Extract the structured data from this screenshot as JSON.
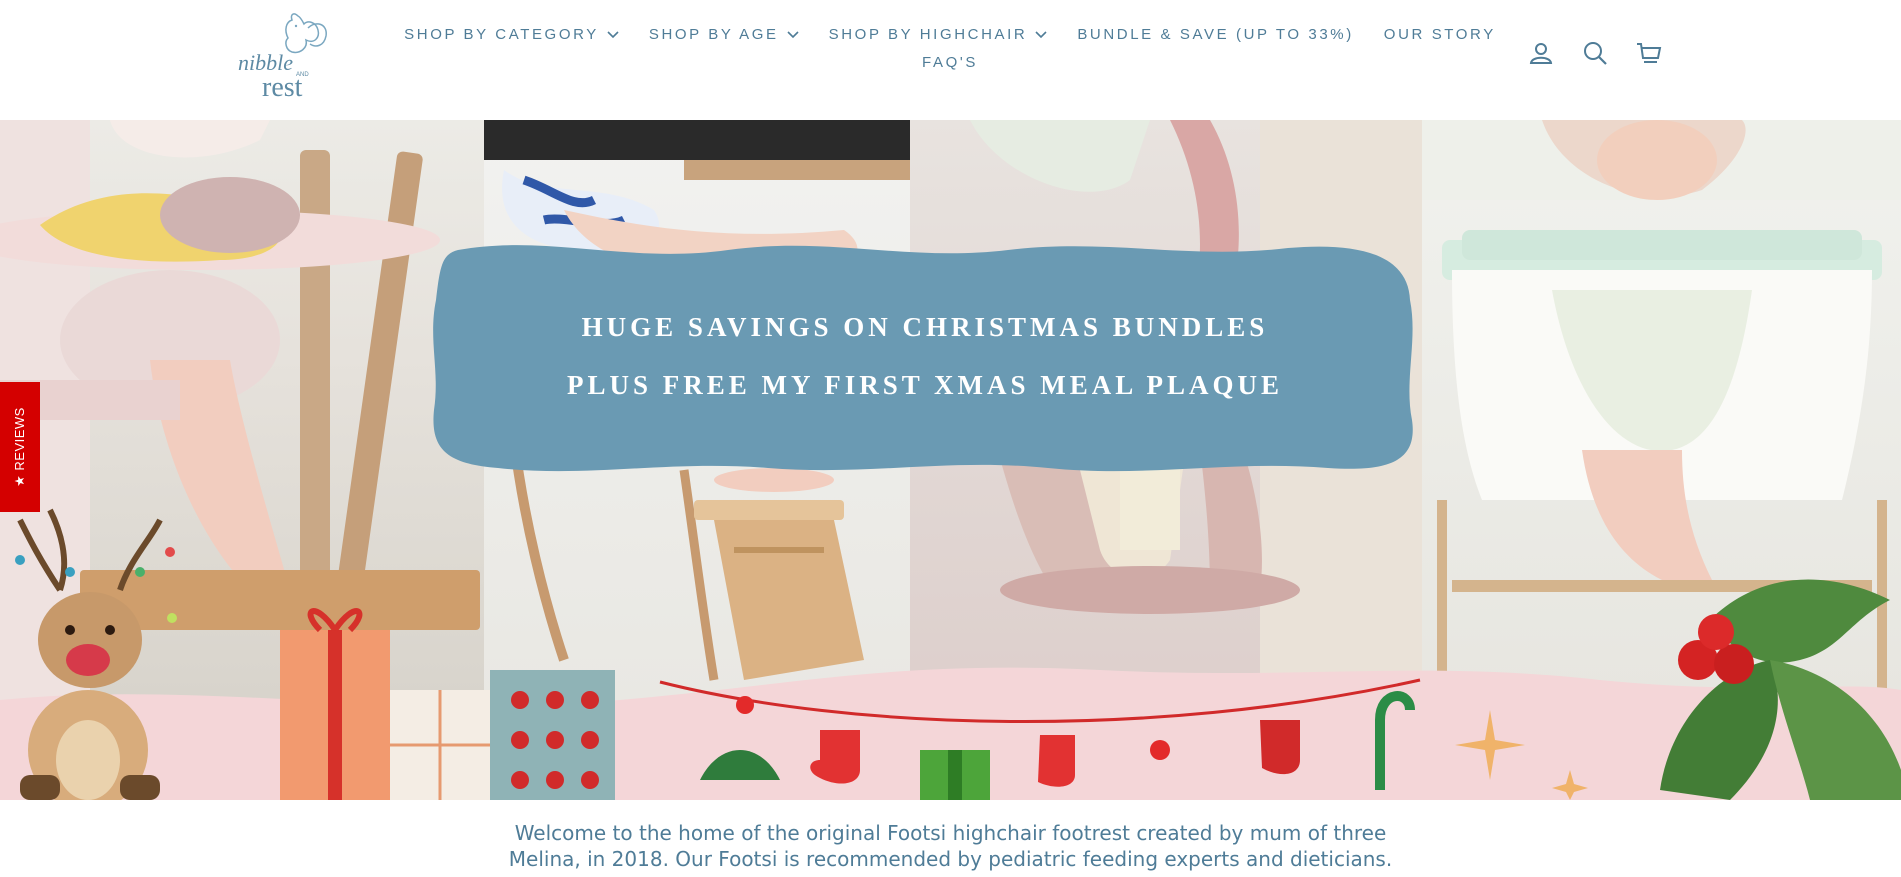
{
  "brand": {
    "logo_text_top": "nibble",
    "logo_text_and": "AND",
    "logo_text_bottom": "rest"
  },
  "nav": {
    "items": [
      {
        "label": "SHOP BY CATEGORY",
        "has_dropdown": true
      },
      {
        "label": "SHOP BY AGE",
        "has_dropdown": true
      },
      {
        "label": "SHOP BY HIGHCHAIR",
        "has_dropdown": true
      },
      {
        "label": "BUNDLE & SAVE (UP TO 33%)",
        "has_dropdown": false
      },
      {
        "label": "OUR STORY",
        "has_dropdown": false
      }
    ],
    "second_row": [
      {
        "label": "FAQ'S"
      }
    ]
  },
  "header_icons": [
    "account-icon",
    "search-icon",
    "cart-icon"
  ],
  "hero": {
    "banner_line1": "HUGE SAVINGS ON CHRISTMAS BUNDLES",
    "banner_line2": "PLUS FREE MY FIRST XMAS MEAL PLAQUE"
  },
  "reviews_tab": {
    "label": "★ REVIEWS"
  },
  "welcome": {
    "line1": "Welcome to the home of the original Footsi highchair footrest created by mum of three",
    "line2": "Melina, in 2018. Our Footsi is recommended by pediatric feeding experts and dieticians."
  },
  "colors": {
    "brand_blue": "#4f7c97",
    "banner_blue": "#6a9ab3",
    "reviews_red": "#d40000",
    "hero_pink": "#f4dfe0"
  }
}
